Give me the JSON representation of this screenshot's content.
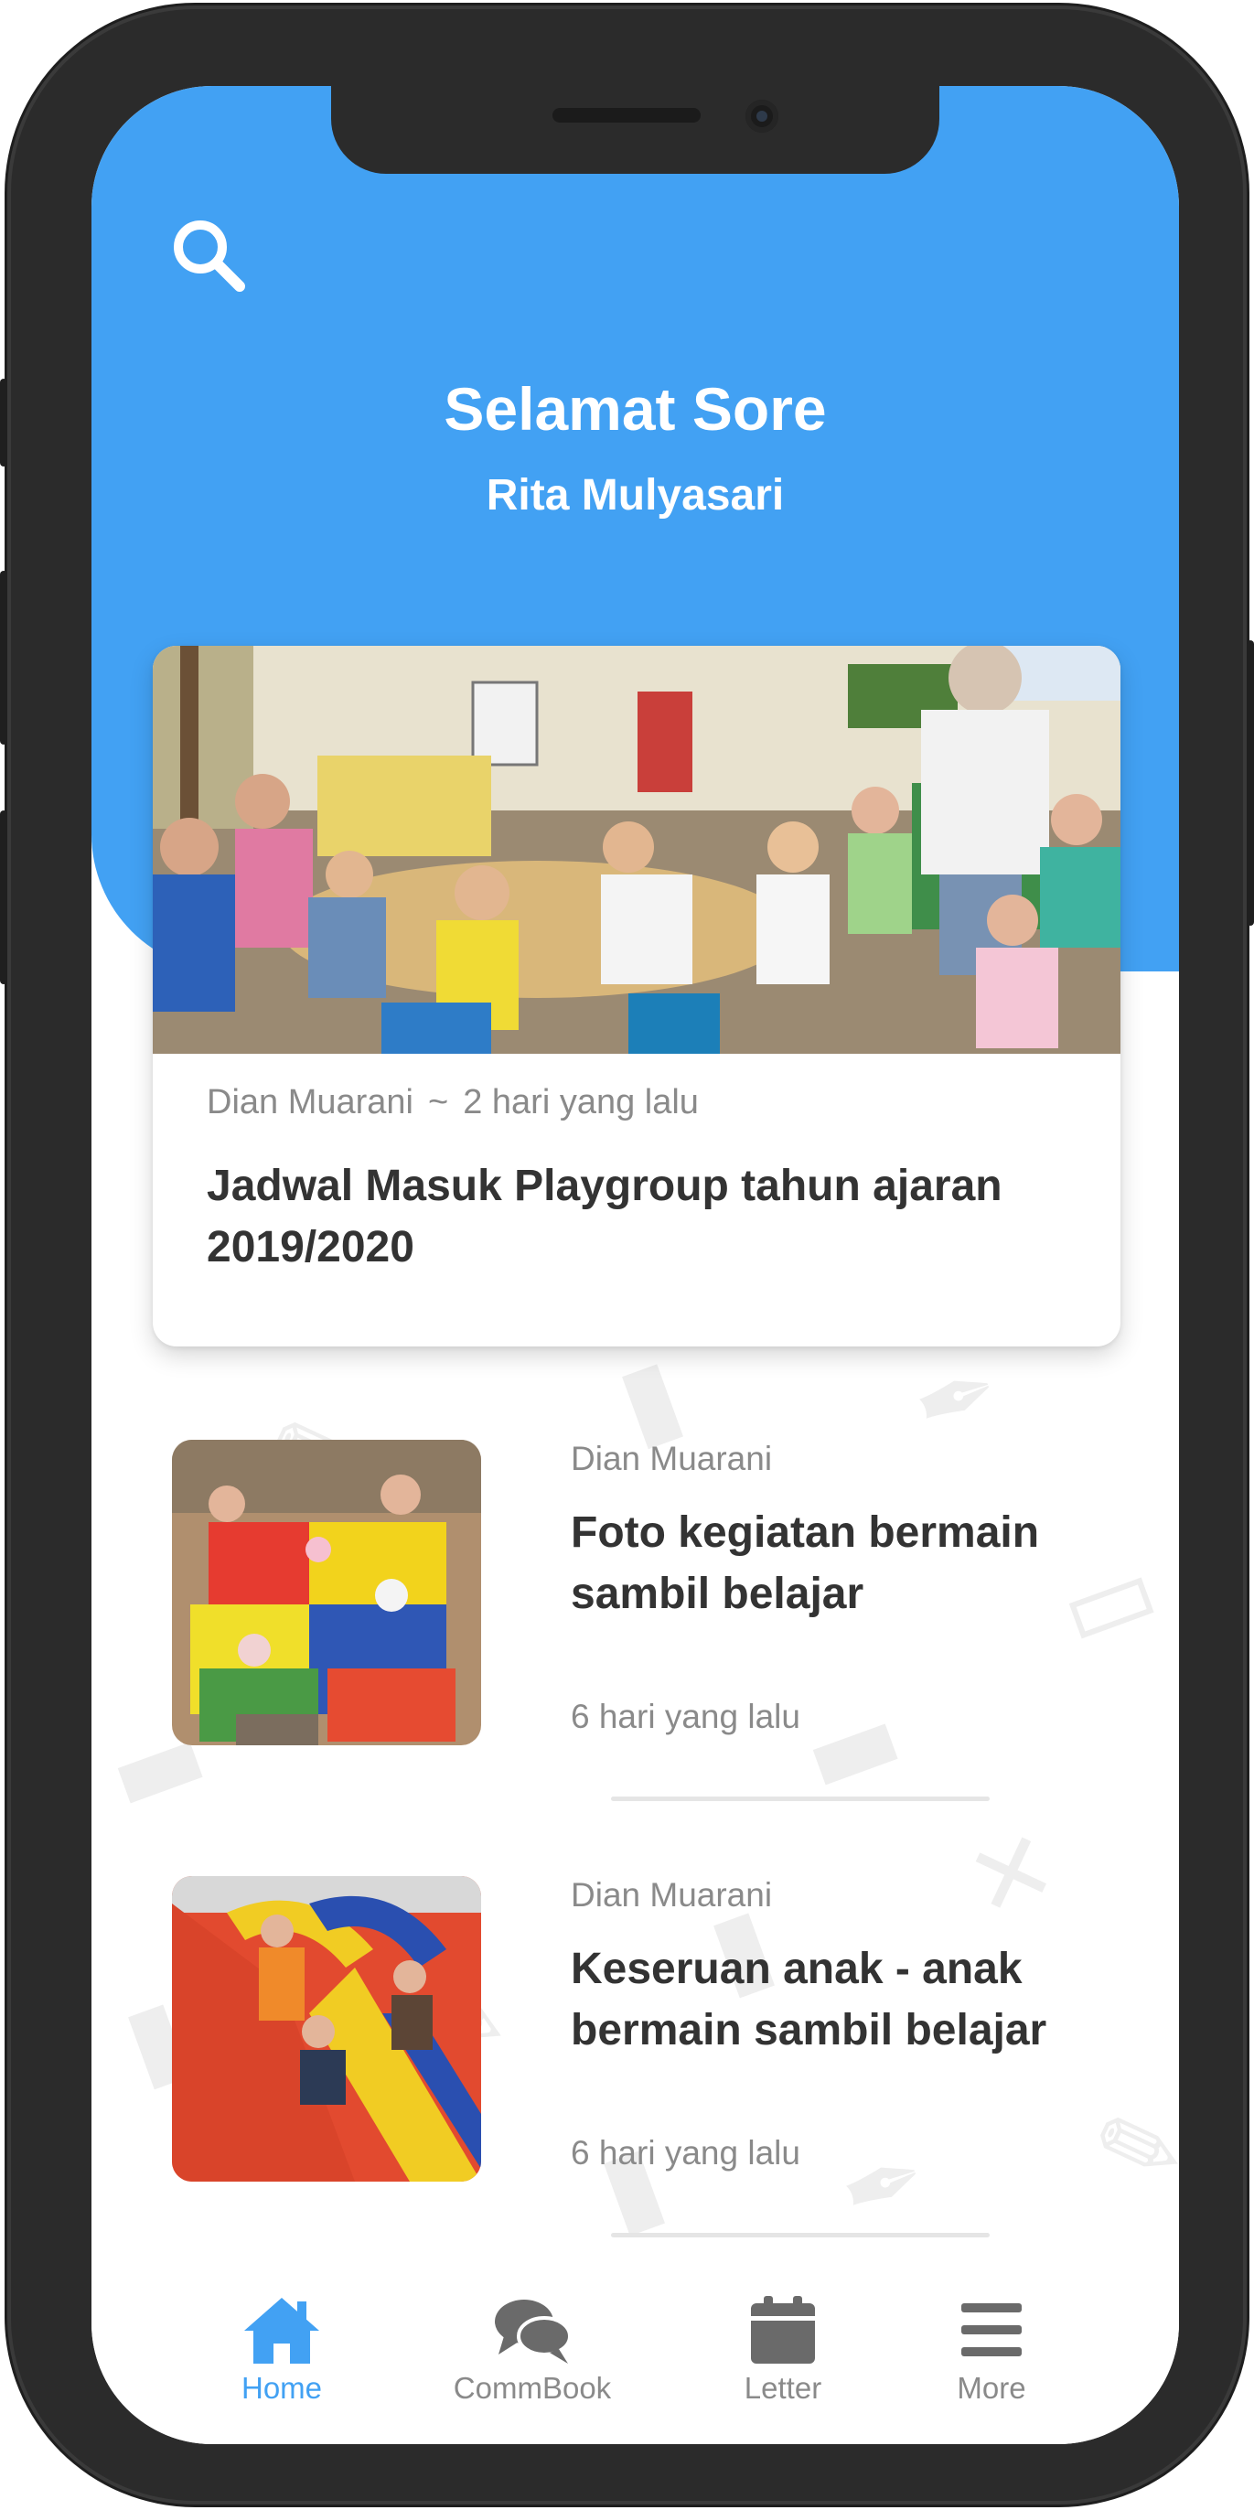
{
  "header": {
    "greeting": "Selamat Sore",
    "user_name": "Rita Mulyasari",
    "search_icon": "search-icon"
  },
  "featured": {
    "author": "Dian Muarani",
    "separator": "~",
    "time": "2 hari yang lalu",
    "title": "Jadwal Masuk Playgroup tahun ajaran 2019/2020"
  },
  "posts": [
    {
      "author": "Dian Muarani",
      "title": "Foto kegiatan bermain sambil belajar",
      "time": "6 hari yang lalu"
    },
    {
      "author": "Dian Muarani",
      "title": "Keseruan anak - anak bermain sambil belajar",
      "time": "6 hari yang lalu"
    }
  ],
  "tabs": [
    {
      "label": "Home",
      "icon": "home-icon",
      "active": true
    },
    {
      "label": "CommBook",
      "icon": "chat-icon",
      "active": false
    },
    {
      "label": "Letter",
      "icon": "calendar-icon",
      "active": false
    },
    {
      "label": "More",
      "icon": "menu-icon",
      "active": false
    }
  ],
  "colors": {
    "accent": "#42a1f3",
    "text_primary": "#333333",
    "text_secondary": "#8a8a8a",
    "frame": "#2b2b2b"
  }
}
